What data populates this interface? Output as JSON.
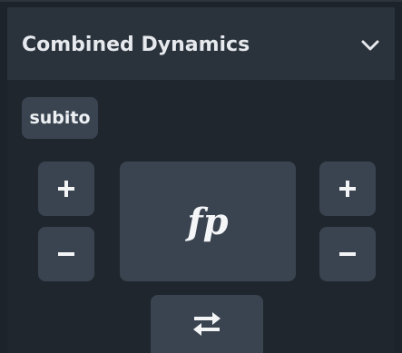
{
  "header": {
    "title": "Combined Dynamics",
    "collapse_icon": "chevron-down-icon"
  },
  "subito_label": "subito",
  "dynamic": "fp",
  "left_controls": {
    "increase_icon": "plus-icon",
    "decrease_icon": "minus-icon"
  },
  "right_controls": {
    "increase_icon": "plus-icon",
    "decrease_icon": "minus-icon"
  },
  "swap_icon": "swap-arrows-icon",
  "colors": {
    "panel_bg": "#1d232a",
    "header_bg": "#2a323c",
    "button_bg": "#3a4450",
    "text": "#e6e9ed"
  }
}
